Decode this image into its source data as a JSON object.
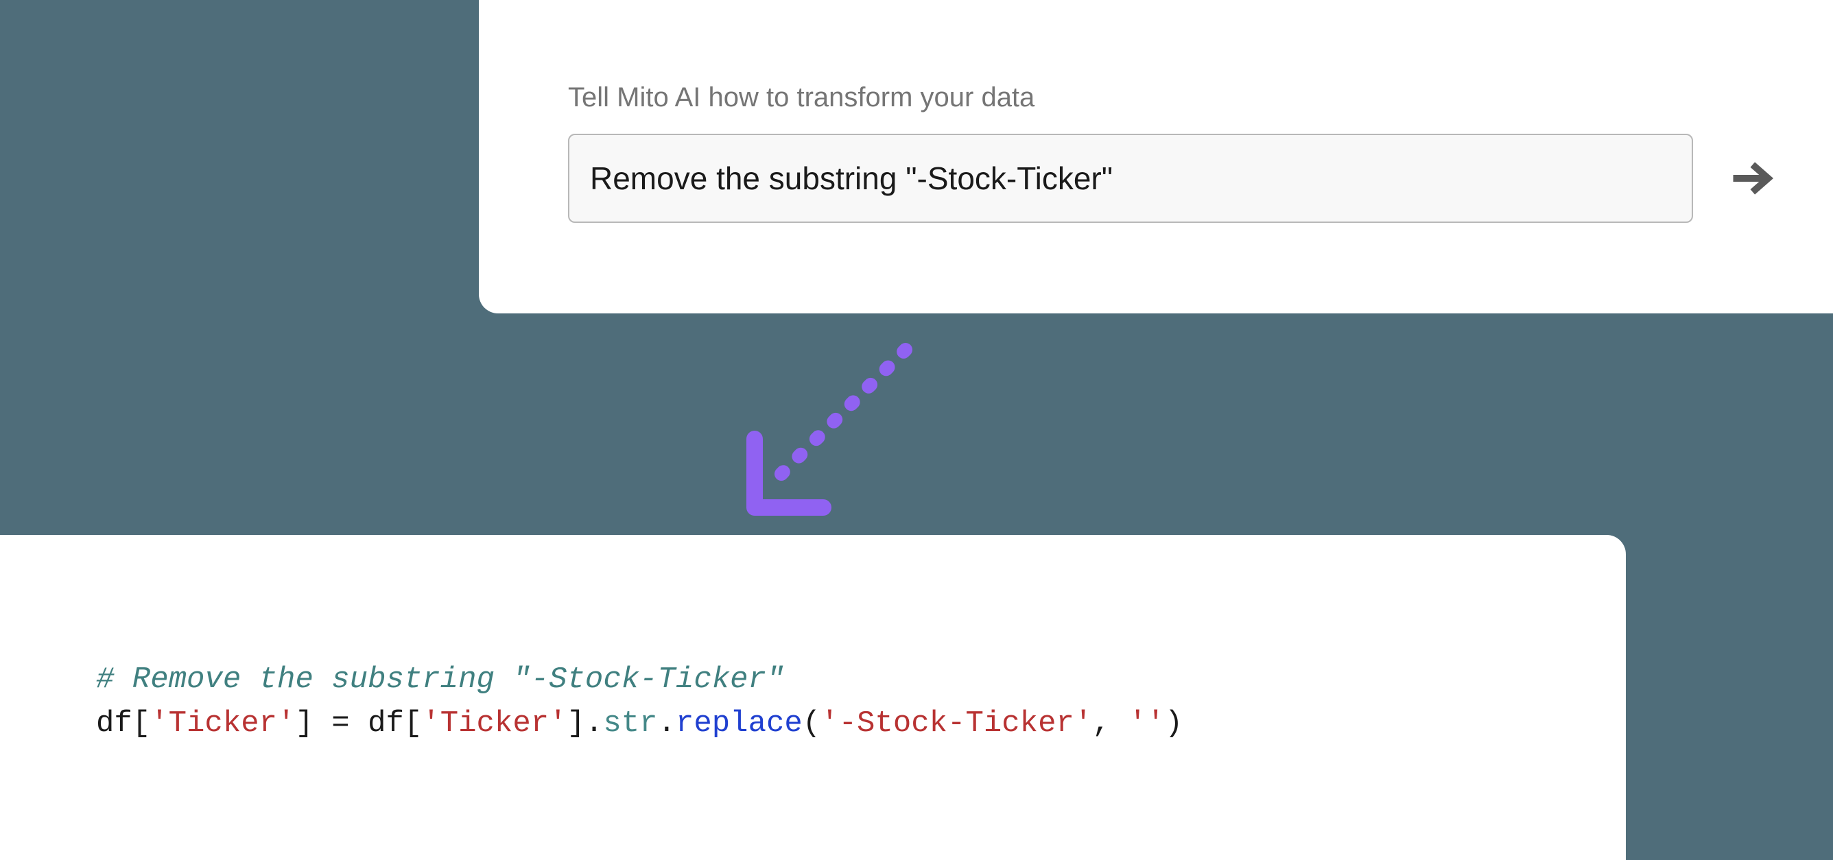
{
  "input_card": {
    "label": "Tell Mito AI how to transform your data",
    "input_value": "Remove the substring \"-Stock-Ticker\"",
    "submit_icon": "arrow-right"
  },
  "code_output": {
    "comment": "# Remove the substring \"-Stock-Ticker\"",
    "line": {
      "p1": "df[",
      "s1": "'Ticker'",
      "p2": "] = df[",
      "s2": "'Ticker'",
      "p3": "].",
      "attr": "str",
      "p4": ".",
      "method": "replace",
      "p5": "(",
      "s3": "'-Stock-Ticker'",
      "p6": ", ",
      "s4": "''",
      "p7": ")"
    }
  },
  "colors": {
    "background": "#4f6d7a",
    "accent_arrow": "#9062f2"
  }
}
